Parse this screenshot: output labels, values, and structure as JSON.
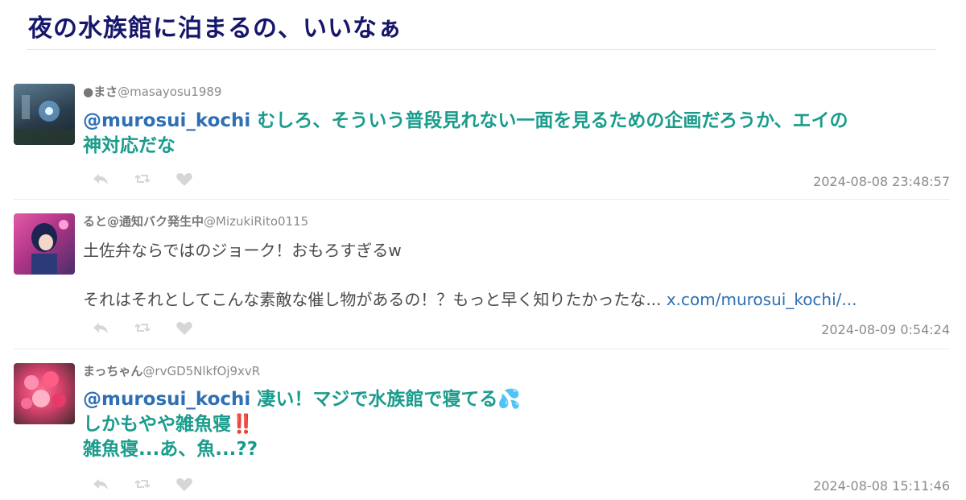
{
  "page": {
    "title": "夜の水族館に泊まるの、いいなぁ"
  },
  "tweets": [
    {
      "display_name": "●まさ",
      "handle": "@masayosu1989",
      "mention": "@murosui_kochi",
      "lines": [
        "むしろ、そういう普段見れない一面を見るための企画だろうか、エイの",
        "神対応だな"
      ],
      "timestamp": "2024-08-08 23:48:57",
      "avatar_color": "#3b5366"
    },
    {
      "display_name": "ると@通知バク発生中",
      "handle": "@MizukiRito0115",
      "line1": "土佐弁ならではのジョーク！おもろすぎるw",
      "line2": "それはそれとしてこんな素敵な催し物があるの！？もっと早く知りたかったな...",
      "link": "x.com/murosui_kochi/...",
      "timestamp": "2024-08-09 0:54:24",
      "avatar_color": "#c93f8e"
    },
    {
      "display_name": "まっちゃん",
      "handle": "@rvGD5NlkfOj9xvR",
      "mention": "@murosui_kochi",
      "lines": [
        "凄い！マジで水族館で寝てる💦",
        "しかもやや雑魚寝‼️",
        "雑魚寝...あ、魚...??"
      ],
      "timestamp": "2024-08-08 15:11:46",
      "avatar_color": "#d0406a"
    }
  ],
  "icons": {
    "reply": "reply-icon",
    "retweet": "retweet-icon",
    "like": "heart-icon"
  },
  "colors": {
    "title": "#16166b",
    "tweet_text": "#1a9c8c",
    "mention": "#2f6fb5",
    "action_icon": "#d6d6d6"
  }
}
